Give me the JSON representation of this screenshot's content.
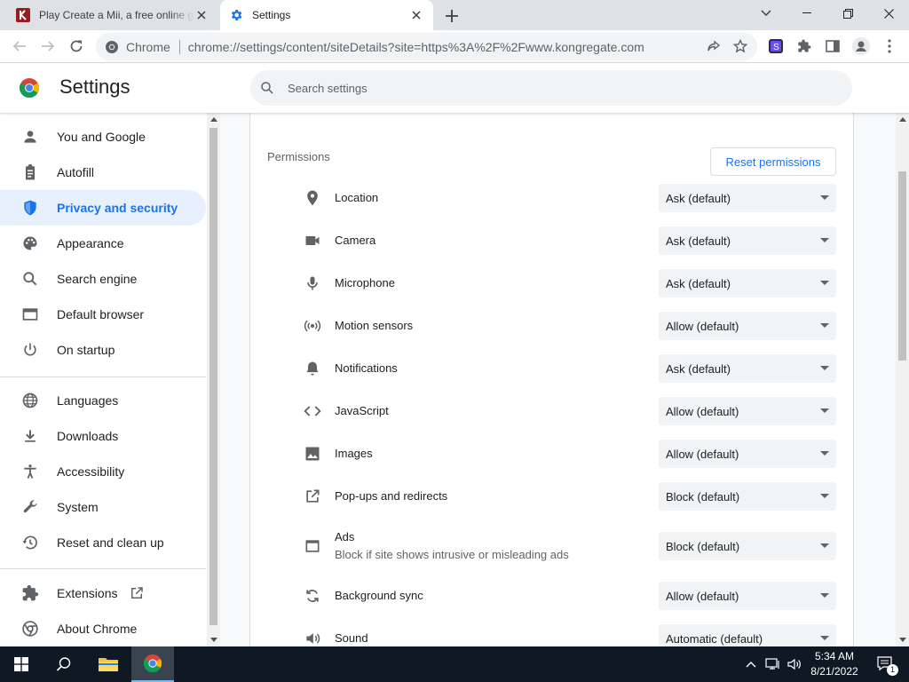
{
  "tabs": [
    {
      "title": "Play Create a Mii, a free online game on Kongregate",
      "favicon": "kongregate-icon",
      "active": false
    },
    {
      "title": "Settings",
      "favicon": "settings-gear-icon",
      "active": true
    }
  ],
  "toolbar": {
    "site_label": "Chrome",
    "url": "chrome://settings/content/siteDetails?site=https%3A%2F%2Fwww.kongregate.com"
  },
  "header": {
    "title": "Settings",
    "search_placeholder": "Search settings"
  },
  "sidebar": {
    "items": [
      {
        "label": "You and Google",
        "icon": "person-icon"
      },
      {
        "label": "Autofill",
        "icon": "clipboard-icon"
      },
      {
        "label": "Privacy and security",
        "icon": "shield-icon",
        "active": true
      },
      {
        "label": "Appearance",
        "icon": "palette-icon"
      },
      {
        "label": "Search engine",
        "icon": "search-icon"
      },
      {
        "label": "Default browser",
        "icon": "browser-icon"
      },
      {
        "label": "On startup",
        "icon": "power-icon"
      },
      {
        "label": "Languages",
        "icon": "globe-icon"
      },
      {
        "label": "Downloads",
        "icon": "download-icon"
      },
      {
        "label": "Accessibility",
        "icon": "accessibility-icon"
      },
      {
        "label": "System",
        "icon": "wrench-icon"
      },
      {
        "label": "Reset and clean up",
        "icon": "history-icon"
      },
      {
        "label": "Extensions",
        "icon": "puzzle-icon"
      },
      {
        "label": "About Chrome",
        "icon": "chrome-icon"
      }
    ]
  },
  "permissions": {
    "heading": "Permissions",
    "reset_label": "Reset permissions",
    "rows": [
      {
        "label": "Location",
        "value": "Ask (default)",
        "icon": "location-pin-icon"
      },
      {
        "label": "Camera",
        "value": "Ask (default)",
        "icon": "camera-icon"
      },
      {
        "label": "Microphone",
        "value": "Ask (default)",
        "icon": "microphone-icon"
      },
      {
        "label": "Motion sensors",
        "value": "Allow (default)",
        "icon": "sensors-icon"
      },
      {
        "label": "Notifications",
        "value": "Ask (default)",
        "icon": "bell-icon"
      },
      {
        "label": "JavaScript",
        "value": "Allow (default)",
        "icon": "code-icon"
      },
      {
        "label": "Images",
        "value": "Allow (default)",
        "icon": "image-icon"
      },
      {
        "label": "Pop-ups and redirects",
        "value": "Block (default)",
        "icon": "external-link-icon"
      },
      {
        "label": "Ads",
        "sublabel": "Block if site shows intrusive or misleading ads",
        "value": "Block (default)",
        "icon": "ads-window-icon"
      },
      {
        "label": "Background sync",
        "value": "Allow (default)",
        "icon": "sync-icon"
      },
      {
        "label": "Sound",
        "value": "Automatic (default)",
        "icon": "speaker-icon"
      }
    ]
  },
  "taskbar": {
    "time": "5:34 AM",
    "date": "8/21/2022",
    "notification_count": "1"
  },
  "colors": {
    "accent": "#1a73e8",
    "active_nav_bg": "#e8f0fe",
    "tabstrip": "#dee1e6",
    "taskbar": "#101923"
  }
}
